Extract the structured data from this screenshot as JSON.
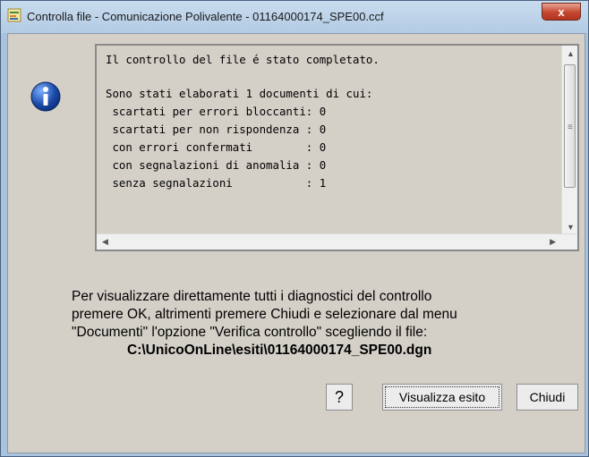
{
  "window": {
    "title": "Controlla file - Comunicazione Polivalente - 01164000174_SPE00.ccf",
    "close_symbol": "x"
  },
  "icons": {
    "app": "app-form-icon",
    "info": "info-icon"
  },
  "log": {
    "lines": [
      "Il controllo del file é stato completato.",
      "",
      "Sono stati elaborati 1 documenti di cui:",
      " scartati per errori bloccanti: 0",
      " scartati per non rispondenza : 0",
      " con errori confermati        : 0",
      " con segnalazioni di anomalia : 0",
      " senza segnalazioni           : 1"
    ]
  },
  "message": {
    "line1": "Per visualizzare  direttamente  tutti  i diagnostici  del controllo",
    "line2": "premere OK, altrimenti premere Chiudi e selezionare dal menu",
    "line3": "\"Documenti\" l'opzione  \"Verifica controllo\" scegliendo il file:",
    "path": "C:\\UnicoOnLine\\esiti\\01164000174_SPE00.dgn"
  },
  "buttons": {
    "help": "?",
    "show": "Visualizza esito",
    "close": "Chiudi"
  },
  "colors": {
    "title_bg": "#b3cbe4",
    "close_btn": "#c5472f",
    "dialog_bg": "#d4d0c8",
    "info_blue": "#1a4aa8"
  }
}
